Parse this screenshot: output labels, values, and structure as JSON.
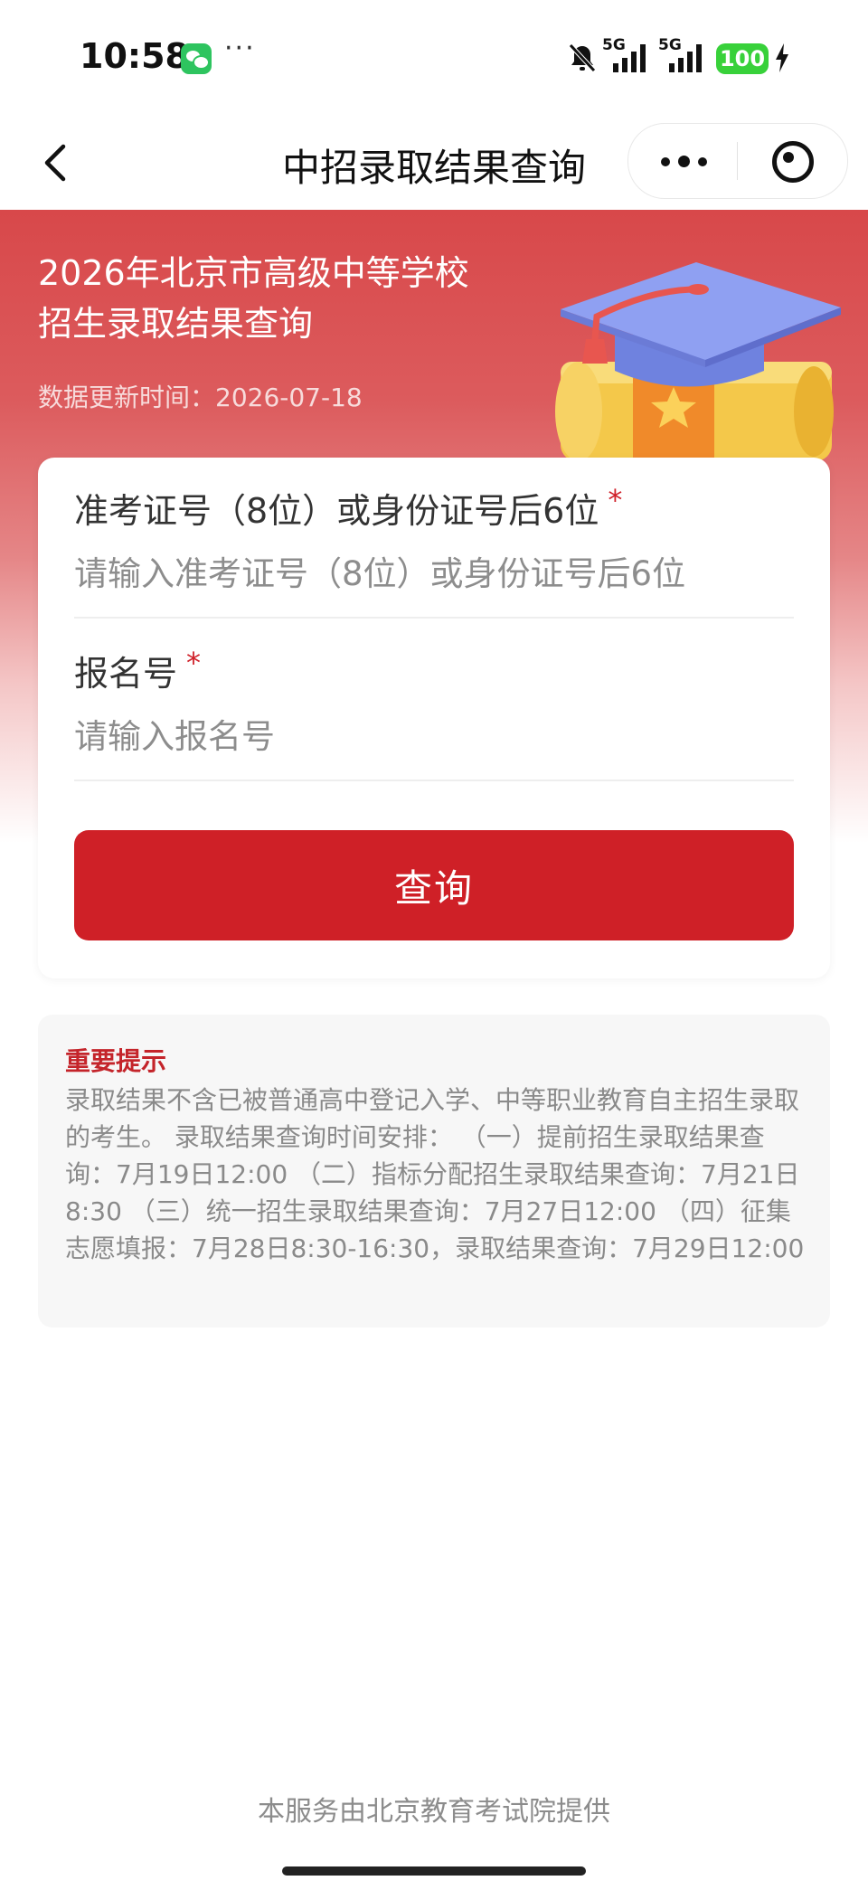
{
  "status_bar": {
    "time": "10:58",
    "more": "···",
    "net1": "5G",
    "net2": "5G",
    "battery": "100",
    "icons": [
      "wechat-icon",
      "bell-muted-icon",
      "signal-icon",
      "battery-icon",
      "charging-bolt-icon"
    ]
  },
  "nav": {
    "title": "中招录取结果查询",
    "icons": [
      "back-arrow-icon",
      "more-icon",
      "close-miniprogram-icon"
    ]
  },
  "hero": {
    "title_line1": "2026年北京市高级中等学校",
    "title_line2": "招生录取结果查询",
    "update_text": "数据更新时间：2026-07-18"
  },
  "form": {
    "ticket_label": "准考证号（8位）或身份证号后6位",
    "ticket_required": "*",
    "ticket_placeholder": "请输入准考证号（8位）或身份证号后6位",
    "ticket_value": "",
    "reg_label": "报名号",
    "reg_required": "*",
    "reg_placeholder": "请输入报名号",
    "reg_value": "",
    "submit_label": "查询"
  },
  "notice": {
    "title": "重要提示",
    "body": "录取结果不含已被普通高中登记入学、中等职业教育自主招生录取的考生。 录取结果查询时间安排： （一）提前招生录取结果查询：7月19日12:00 （二）指标分配招生录取结果查询：7月21日8:30 （三）统一招生录取结果查询：7月27日12:00 （四）征集志愿填报：7月28日8:30-16:30，录取结果查询：7月29日12:00"
  },
  "footer": {
    "text": "本服务由北京教育考试院提供"
  },
  "colors": {
    "brand_red": "#cf2027",
    "hero_red": "#d8484a",
    "notice_title": "#c4242a"
  }
}
